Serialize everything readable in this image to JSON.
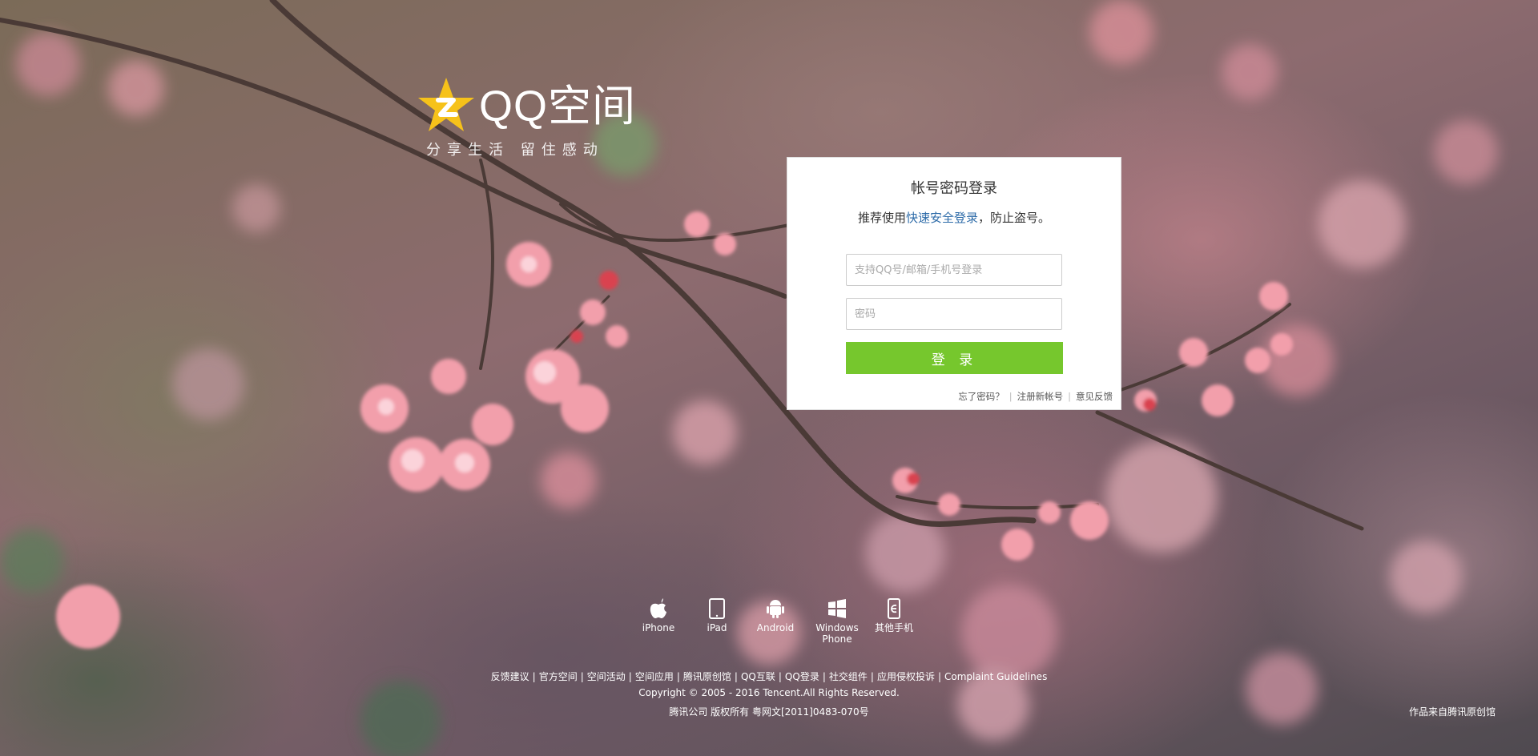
{
  "logo": {
    "text": "QQ空间",
    "slogan": "分享生活  留住感动",
    "brand_color": "#f6c21a"
  },
  "login": {
    "title": "帐号密码登录",
    "subtitle_prefix": "推荐使用",
    "subtitle_link": "快速安全登录",
    "subtitle_suffix": "，防止盗号。",
    "account_placeholder": "支持QQ号/邮箱/手机号登录",
    "account_value": "",
    "password_placeholder": "密码",
    "password_value": "",
    "submit_label": "登 录",
    "button_color": "#76c72d",
    "links": [
      "忘了密码？",
      "注册新帐号",
      "意见反馈"
    ]
  },
  "platforms": [
    {
      "label": "iPhone",
      "icon": "apple-icon"
    },
    {
      "label": "iPad",
      "icon": "ipad-icon"
    },
    {
      "label": "Android",
      "icon": "android-icon"
    },
    {
      "label": "Windows Phone",
      "icon": "windows-icon"
    },
    {
      "label": "其他手机",
      "icon": "phone-icon"
    }
  ],
  "footer": {
    "links": [
      "反馈建议",
      "官方空间",
      "空间活动",
      "空间应用",
      "腾讯原创馆",
      "QQ互联",
      "QQ登录",
      "社交组件",
      "应用侵权投诉",
      "Complaint Guidelines"
    ],
    "copyright": "Copyright © 2005 - 2016 Tencent.All Rights Reserved.",
    "icp": "腾讯公司 版权所有 粤网文[2011]0483-070号",
    "credit": "作品来自腾讯原创馆"
  }
}
